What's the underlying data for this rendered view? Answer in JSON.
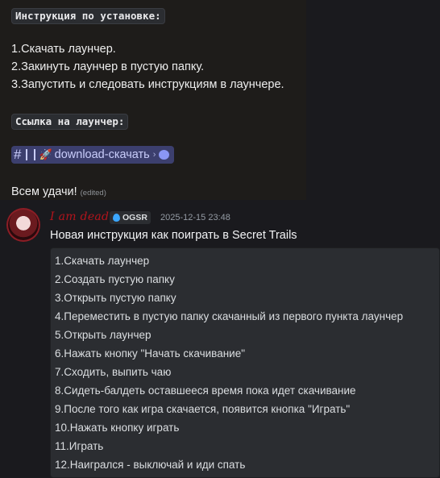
{
  "top": {
    "install_header": "Инструкция по установке:",
    "steps": [
      "1.Скачать лаунчер.",
      "2.Закинуть лаунчер в пустую папку.",
      "3.Запустить и следовать инструкциям в лаунчере."
    ],
    "link_header": "Ссылка на лаунчер:",
    "channel": {
      "hash": "#",
      "rocket": "🚀",
      "name": "download-скачать",
      "chevron": "›"
    },
    "closing": "Всем удачи!",
    "edited": "(edited)"
  },
  "message": {
    "username": "I am dead",
    "tag": "OGSR",
    "timestamp": "2025-12-15 23:48",
    "title": "Новая инструкция как поиграть в Secret Trails",
    "steps": [
      "1.Скачать лаунчер",
      "2.Создать пустую папку",
      "3.Открыть пустую папку",
      "4.Переместить в пустую папку скачанный из первого пункта лаунчер",
      "5.Открыть лаунчер",
      "6.Нажать кнопку \"Начать скачивание\"",
      "7.Сходить, выпить чаю",
      "8.Сидеть-балдеть оставшееся время пока идет скачивание",
      "9.После того как игра скачается, появится кнопка \"Играть\"",
      "10.Нажать кнопку играть",
      "11.Играть",
      "12.Наигрался - выключай и иди спать"
    ]
  },
  "colors": {
    "username": "#b3141c",
    "mention_bg": "#3c3f6e",
    "codeblock_bg": "#2b2d31"
  }
}
